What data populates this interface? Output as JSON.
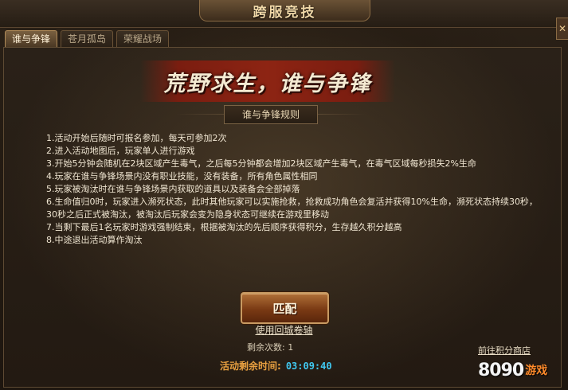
{
  "header": {
    "title": "跨服竞技"
  },
  "tabs": [
    {
      "label": "谁与争锋",
      "active": true
    },
    {
      "label": "苍月孤岛",
      "active": false
    },
    {
      "label": "荣耀战场",
      "active": false
    }
  ],
  "banner": {
    "title": "荒野求生，谁与争锋"
  },
  "rules": {
    "heading": "谁与争锋规则",
    "items": [
      "1.活动开始后随时可报名参加，每天可参加2次",
      "2.进入活动地图后，玩家单人进行游戏",
      "3.开始5分钟会随机在2块区域产生毒气，之后每5分钟都会增加2块区域产生毒气，在毒气区域每秒损失2%生命",
      "4.玩家在谁与争锋场景内没有职业技能，没有装备，所有角色属性相同",
      "5.玩家被淘汰时在谁与争锋场景内获取的道具以及装备会全部掉落",
      "6.生命值归0时，玩家进入濒死状态，此时其他玩家可以实施抢救，抢救成功角色会复活并获得10%生命，濒死状态持续30秒，30秒之后正式被淘汰，被淘汰后玩家会变为隐身状态可继续在游戏里移动",
      "7.当剩下最后1名玩家时游戏强制结束，根据被淘汰的先后顺序获得积分，生存越久积分越高",
      "8.中途退出活动算作淘汰"
    ]
  },
  "actions": {
    "match_label": "匹配",
    "scroll_label": "使用回城卷轴",
    "remaining": "剩余次数: 1",
    "timer_label": "活动剩余时间:",
    "timer_value": "03:09:40",
    "shop_label": "前往积分商店"
  },
  "watermark": {
    "text": "8090",
    "sub": "游戏"
  },
  "colors": {
    "timer_label": "#e8a040",
    "timer_value": "#40c8f0",
    "banner": "#8d2413"
  }
}
